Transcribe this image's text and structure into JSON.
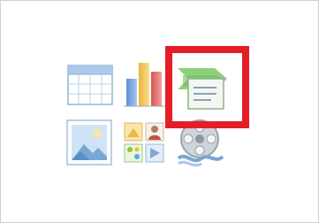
{
  "placeholder": {
    "icons": [
      "insert-table-icon",
      "insert-chart-icon",
      "insert-smartart-icon",
      "insert-picture-icon",
      "insert-clip-art-icon",
      "insert-media-clip-icon"
    ],
    "highlighted": "insert-smartart-icon"
  },
  "colors": {
    "highlight": "#e41e26",
    "border": "#c9d2da",
    "smartart_green": "#7cc576",
    "table_blue": "#6fa8dc"
  }
}
